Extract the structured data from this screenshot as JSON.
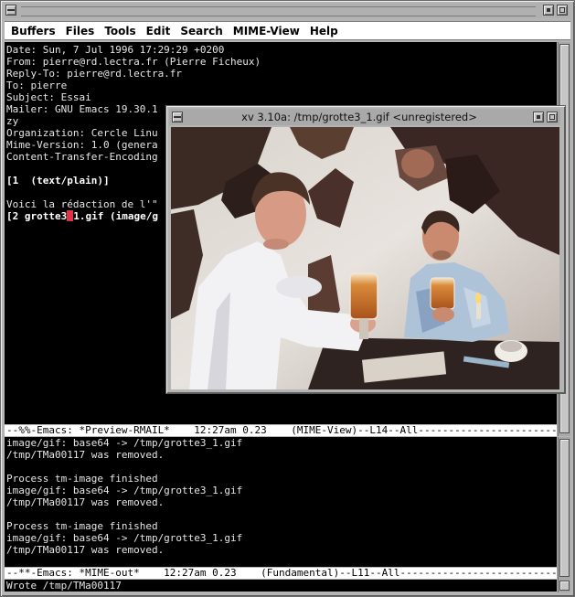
{
  "menubar": {
    "items": [
      "Buffers",
      "Files",
      "Tools",
      "Edit",
      "Search",
      "MIME-View",
      "Help"
    ]
  },
  "preview_buffer": {
    "lines": [
      "Date: Sun, 7 Jul 1996 17:29:29 +0200",
      "From: pierre@rd.lectra.fr (Pierre Ficheux)",
      "Reply-To: pierre@rd.lectra.fr",
      "To: pierre",
      "Subject: Essai",
      "Mailer: GNU Emacs 19.30.1",
      "zy",
      "Organization: Cercle Linu",
      "Mime-Version: 1.0 (genera",
      "Content-Transfer-Encoding"
    ],
    "part1": "[1  (text/plain)]",
    "body": "Voici la rédaction de l'\"",
    "part2_before_cursor": "[2 grotte3",
    "part2_cursor_char": "_",
    "part2_after_cursor": "1.gif (image/g"
  },
  "modeline_preview": "--%%-Emacs: *Preview-RMAIL*    12:27am 0.23    (MIME-View)--L14--All-----------------------------------",
  "output_buffer": {
    "lines": [
      "image/gif: base64 -> /tmp/grotte3_1.gif",
      "/tmp/TMa00117 was removed.",
      "",
      "Process tm-image finished",
      "image/gif: base64 -> /tmp/grotte3_1.gif",
      "/tmp/TMa00117 was removed.",
      "",
      "Process tm-image finished",
      "image/gif: base64 -> /tmp/grotte3_1.gif",
      "/tmp/TMa00117 was removed."
    ]
  },
  "modeline_output": "--**-Emacs: *MIME-out*    12:27am 0.23    (Fundamental)--L11--All-----------------------------------",
  "minibuffer": "Wrote /tmp/TMa00117",
  "xv_window": {
    "title": "xv 3.10a: /tmp/grotte3_1.gif <unregistered>"
  }
}
